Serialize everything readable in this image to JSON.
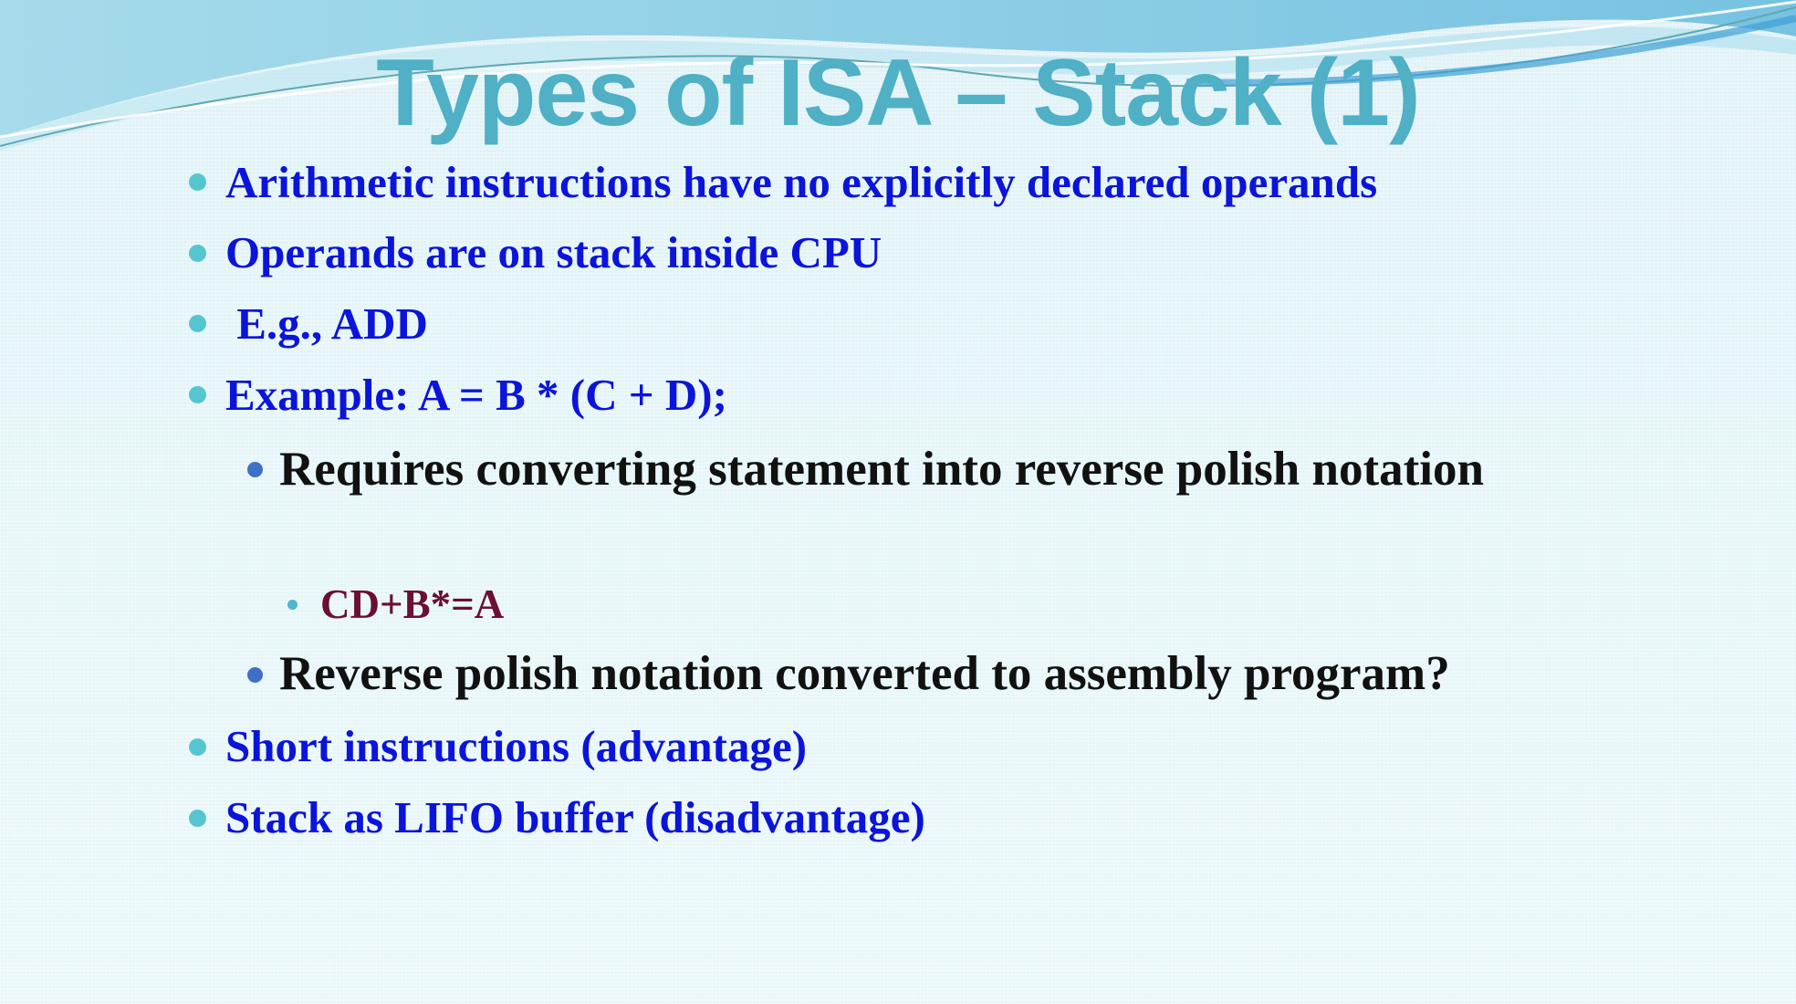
{
  "slide": {
    "title": "Types of ISA – Stack (1)",
    "bullets": [
      "Arithmetic instructions have no explicitly declared operands",
      "Operands are on stack inside CPU",
      " E.g., ADD",
      "Example: A = B * (C + D);"
    ],
    "sub_bullets": [
      "Requires converting statement into reverse polish notation",
      "Reverse polish notation converted to assembly program?"
    ],
    "sub_sub_bullet": "CD+B*=A",
    "bullets_after": [
      "Short instructions (advantage)",
      "Stack as LIFO buffer (disadvantage)"
    ]
  },
  "colors": {
    "title": "#4fb0c6",
    "level1_text": "#0b14d9",
    "level2_text": "#111111",
    "level3_text": "#6b0f33",
    "level1_bullet": "#55c6cf",
    "level2_bullet": "#3f6fc6"
  }
}
